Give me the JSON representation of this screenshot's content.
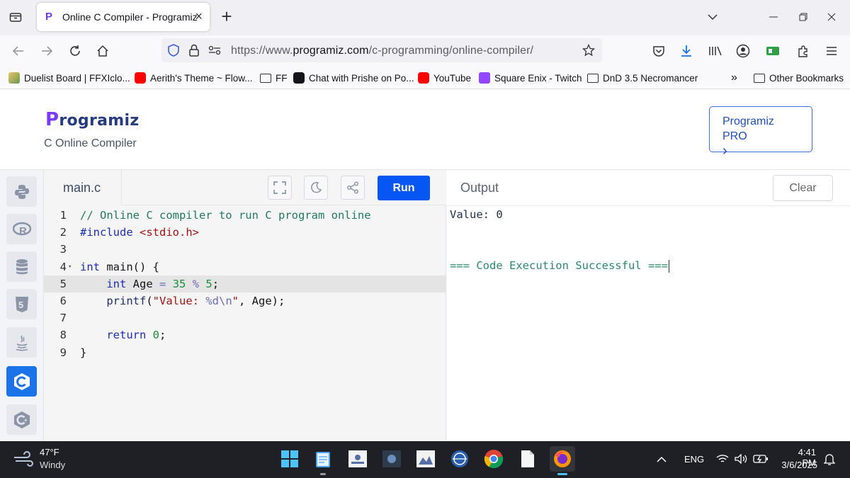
{
  "browser": {
    "tab": {
      "title": "Online C Compiler - Programiz"
    },
    "url": {
      "prefix": "https://www.",
      "domain": "programiz.com",
      "path": "/c-programming/online-compiler/"
    },
    "bookmarks": [
      {
        "label": "Duelist Board | FFXIclo...",
        "icon": "duelist-icon"
      },
      {
        "label": "Aerith's Theme ~ Flow...",
        "icon": "youtube-icon"
      },
      {
        "label": "FF",
        "icon": "folder-icon"
      },
      {
        "label": "Chat with Prishe on Po...",
        "icon": "poe-icon"
      },
      {
        "label": "YouTube",
        "icon": "youtube-icon"
      },
      {
        "label": "Square Enix - Twitch",
        "icon": "twitch-icon"
      },
      {
        "label": "DnD 3.5 Necromancer",
        "icon": "folder-icon"
      },
      {
        "label": "Other Bookmarks",
        "icon": "folder-icon"
      }
    ]
  },
  "site": {
    "logo": {
      "p": "P",
      "rest": "rogramiz"
    },
    "subtitle": "C Online Compiler",
    "pro_button": {
      "line1": "Programiz PRO",
      "line2": "›"
    }
  },
  "sidebar": {
    "languages": [
      "python-icon",
      "r-icon",
      "sql-icon",
      "html5-icon",
      "java-icon",
      "c-icon",
      "cpp-icon"
    ],
    "active": "c-icon"
  },
  "editor": {
    "file_name": "main.c",
    "run_label": "Run",
    "line_numbers": [
      "1",
      "2",
      "3",
      "4",
      "5",
      "6",
      "7",
      "8",
      "9"
    ],
    "highlighted_line": "5"
  },
  "output": {
    "title": "Output",
    "clear_label": "Clear",
    "lines": [
      "Value: 0",
      "=== Code Execution Successful ==="
    ]
  },
  "taskbar": {
    "weather": {
      "temp": "47°F",
      "condition": "Windy"
    },
    "language": "ENG",
    "time": "4:41 PM",
    "date": "3/6/2025"
  },
  "colors": {
    "run_button": "#0556f3",
    "active_language": "#1a73e8",
    "logo_p": "#7a3cff",
    "logo_text": "#253b80"
  }
}
